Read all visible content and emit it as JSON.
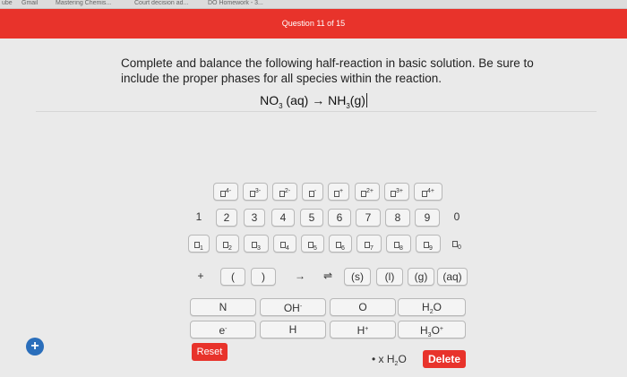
{
  "browser": {
    "bookmarks": [
      "ube",
      "Gmail",
      "Mastering Chemis...",
      "Court decision ad...",
      "DO Homework - 3..."
    ]
  },
  "header": {
    "title": "Question 11 of 15",
    "color": "#e8332b"
  },
  "question": {
    "text": "Complete and balance the following half-reaction in basic solution. Be sure to include the proper phases for all species within the reaction.",
    "reaction": {
      "reactant": "NO",
      "reactant_sub": "3",
      "reactant_phase": "(aq)",
      "arrow": "→",
      "product": "NH",
      "product_sub": "3",
      "product_phase": "(g)"
    }
  },
  "keypad": {
    "charge_row": [
      {
        "sup": "4-"
      },
      {
        "sup": "3-"
      },
      {
        "sup": "2-"
      },
      {
        "sup": "-"
      },
      {
        "sup": "+"
      },
      {
        "sup": "2+"
      },
      {
        "sup": "3+"
      },
      {
        "sup": "4+"
      }
    ],
    "digits": [
      "1",
      "2",
      "3",
      "4",
      "5",
      "6",
      "7",
      "8",
      "9",
      "0"
    ],
    "subscripts": [
      "1",
      "2",
      "3",
      "4",
      "5",
      "6",
      "7",
      "8",
      "9",
      "0"
    ],
    "operators": [
      "+",
      "(",
      ")",
      "→",
      "⇌",
      "(s)",
      "(l)",
      "(g)",
      "(aq)"
    ],
    "species_row1": [
      "N",
      "OH",
      "O",
      "H"
    ],
    "species_row1_sub": [
      "",
      "-",
      "",
      "2"
    ],
    "species_row2": [
      "e",
      "H",
      "H",
      "H"
    ],
    "species_h2o": "O",
    "species_h3o": "O",
    "reset": "Reset",
    "xh2o": "• x H",
    "xh2o_o": "O",
    "delete": "Delete"
  },
  "fab": {
    "label": "+",
    "color": "#2a6ebb"
  }
}
